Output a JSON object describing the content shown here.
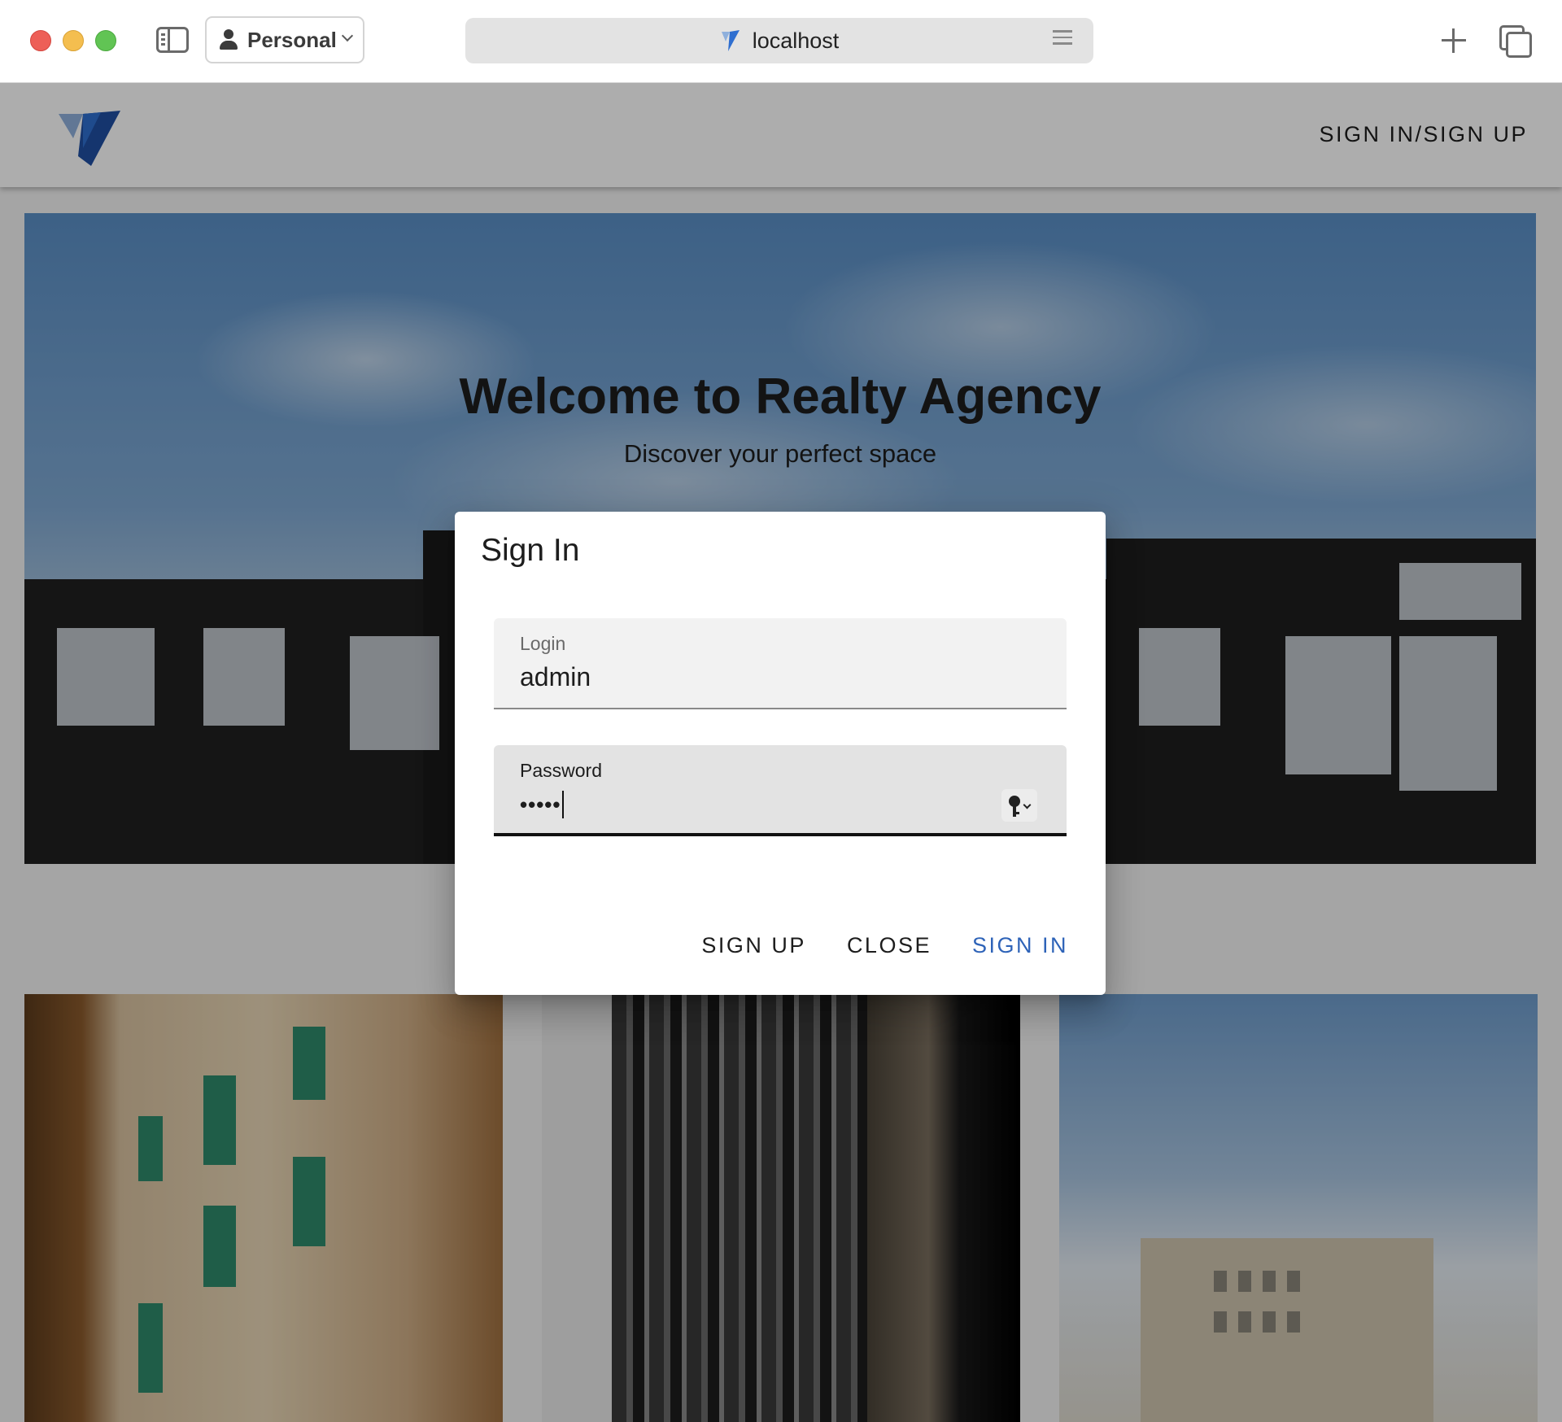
{
  "browser": {
    "profile_label": "Personal",
    "url": "localhost"
  },
  "appbar": {
    "nav_link": "SIGN IN/SIGN UP"
  },
  "hero": {
    "title": "Welcome to Realty Agency",
    "subtitle": "Discover your perfect space"
  },
  "dialog": {
    "title": "Sign In",
    "login": {
      "label": "Login",
      "value": "admin"
    },
    "password": {
      "label": "Password",
      "masked_value": "•••••"
    },
    "buttons": {
      "sign_up": "SIGN UP",
      "close": "CLOSE",
      "sign_in": "SIGN IN"
    }
  },
  "colors": {
    "primary": "#2e63b8",
    "logo_dark": "#1f4fa3",
    "logo_light": "#8fb0dc"
  }
}
